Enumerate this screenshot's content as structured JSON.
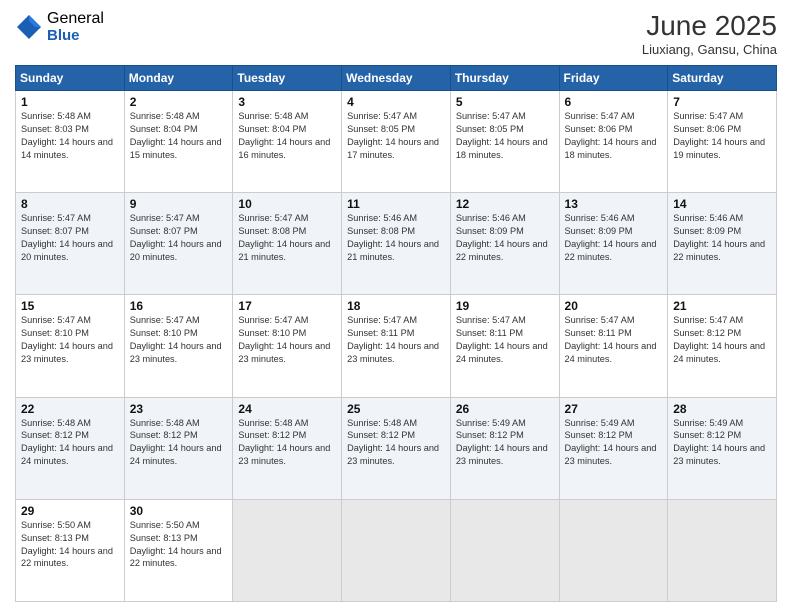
{
  "header": {
    "logo_general": "General",
    "logo_blue": "Blue",
    "title": "June 2025",
    "location": "Liuxiang, Gansu, China"
  },
  "days_of_week": [
    "Sunday",
    "Monday",
    "Tuesday",
    "Wednesday",
    "Thursday",
    "Friday",
    "Saturday"
  ],
  "weeks": [
    [
      {
        "day": 1,
        "sunrise": "5:48 AM",
        "sunset": "8:03 PM",
        "daylight": "14 hours and 14 minutes."
      },
      {
        "day": 2,
        "sunrise": "5:48 AM",
        "sunset": "8:04 PM",
        "daylight": "14 hours and 15 minutes."
      },
      {
        "day": 3,
        "sunrise": "5:48 AM",
        "sunset": "8:04 PM",
        "daylight": "14 hours and 16 minutes."
      },
      {
        "day": 4,
        "sunrise": "5:47 AM",
        "sunset": "8:05 PM",
        "daylight": "14 hours and 17 minutes."
      },
      {
        "day": 5,
        "sunrise": "5:47 AM",
        "sunset": "8:05 PM",
        "daylight": "14 hours and 18 minutes."
      },
      {
        "day": 6,
        "sunrise": "5:47 AM",
        "sunset": "8:06 PM",
        "daylight": "14 hours and 18 minutes."
      },
      {
        "day": 7,
        "sunrise": "5:47 AM",
        "sunset": "8:06 PM",
        "daylight": "14 hours and 19 minutes."
      }
    ],
    [
      {
        "day": 8,
        "sunrise": "5:47 AM",
        "sunset": "8:07 PM",
        "daylight": "14 hours and 20 minutes."
      },
      {
        "day": 9,
        "sunrise": "5:47 AM",
        "sunset": "8:07 PM",
        "daylight": "14 hours and 20 minutes."
      },
      {
        "day": 10,
        "sunrise": "5:47 AM",
        "sunset": "8:08 PM",
        "daylight": "14 hours and 21 minutes."
      },
      {
        "day": 11,
        "sunrise": "5:46 AM",
        "sunset": "8:08 PM",
        "daylight": "14 hours and 21 minutes."
      },
      {
        "day": 12,
        "sunrise": "5:46 AM",
        "sunset": "8:09 PM",
        "daylight": "14 hours and 22 minutes."
      },
      {
        "day": 13,
        "sunrise": "5:46 AM",
        "sunset": "8:09 PM",
        "daylight": "14 hours and 22 minutes."
      },
      {
        "day": 14,
        "sunrise": "5:46 AM",
        "sunset": "8:09 PM",
        "daylight": "14 hours and 22 minutes."
      }
    ],
    [
      {
        "day": 15,
        "sunrise": "5:47 AM",
        "sunset": "8:10 PM",
        "daylight": "14 hours and 23 minutes."
      },
      {
        "day": 16,
        "sunrise": "5:47 AM",
        "sunset": "8:10 PM",
        "daylight": "14 hours and 23 minutes."
      },
      {
        "day": 17,
        "sunrise": "5:47 AM",
        "sunset": "8:10 PM",
        "daylight": "14 hours and 23 minutes."
      },
      {
        "day": 18,
        "sunrise": "5:47 AM",
        "sunset": "8:11 PM",
        "daylight": "14 hours and 23 minutes."
      },
      {
        "day": 19,
        "sunrise": "5:47 AM",
        "sunset": "8:11 PM",
        "daylight": "14 hours and 24 minutes."
      },
      {
        "day": 20,
        "sunrise": "5:47 AM",
        "sunset": "8:11 PM",
        "daylight": "14 hours and 24 minutes."
      },
      {
        "day": 21,
        "sunrise": "5:47 AM",
        "sunset": "8:12 PM",
        "daylight": "14 hours and 24 minutes."
      }
    ],
    [
      {
        "day": 22,
        "sunrise": "5:48 AM",
        "sunset": "8:12 PM",
        "daylight": "14 hours and 24 minutes."
      },
      {
        "day": 23,
        "sunrise": "5:48 AM",
        "sunset": "8:12 PM",
        "daylight": "14 hours and 24 minutes."
      },
      {
        "day": 24,
        "sunrise": "5:48 AM",
        "sunset": "8:12 PM",
        "daylight": "14 hours and 23 minutes."
      },
      {
        "day": 25,
        "sunrise": "5:48 AM",
        "sunset": "8:12 PM",
        "daylight": "14 hours and 23 minutes."
      },
      {
        "day": 26,
        "sunrise": "5:49 AM",
        "sunset": "8:12 PM",
        "daylight": "14 hours and 23 minutes."
      },
      {
        "day": 27,
        "sunrise": "5:49 AM",
        "sunset": "8:12 PM",
        "daylight": "14 hours and 23 minutes."
      },
      {
        "day": 28,
        "sunrise": "5:49 AM",
        "sunset": "8:12 PM",
        "daylight": "14 hours and 23 minutes."
      }
    ],
    [
      {
        "day": 29,
        "sunrise": "5:50 AM",
        "sunset": "8:13 PM",
        "daylight": "14 hours and 22 minutes."
      },
      {
        "day": 30,
        "sunrise": "5:50 AM",
        "sunset": "8:13 PM",
        "daylight": "14 hours and 22 minutes."
      },
      null,
      null,
      null,
      null,
      null
    ]
  ]
}
